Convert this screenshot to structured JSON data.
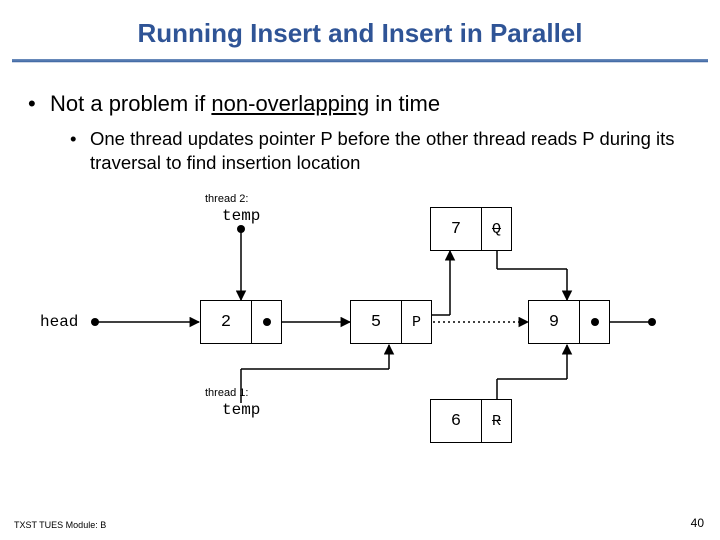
{
  "title": "Running Insert and Insert in Parallel",
  "bullets": {
    "b1_pre": "Not a problem if ",
    "b1_underlined": "non-overlapping",
    "b1_post": " in time",
    "b2": "One thread updates pointer P before the other thread reads P during its traversal to find insertion location"
  },
  "labels": {
    "head": "head",
    "thread1_lbl": "thread 1:",
    "thread2_lbl": "thread 2:",
    "temp": "temp"
  },
  "nodes": {
    "n2": "2",
    "n5": "5",
    "n6": "6",
    "n7": "7",
    "n9": "9"
  },
  "ptrs": {
    "P": "P",
    "Q": "Q",
    "R": "R"
  },
  "footer": {
    "left": "TXST TUES Module: B",
    "page": "40"
  }
}
